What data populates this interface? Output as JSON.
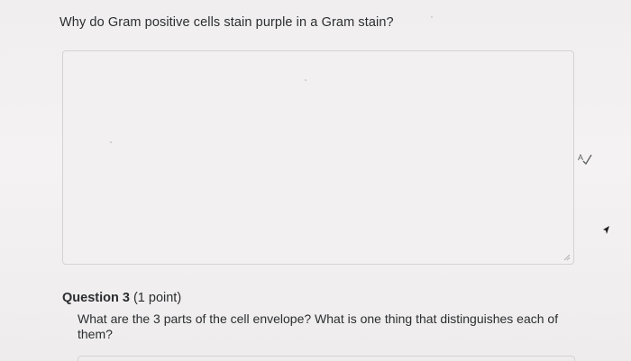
{
  "question2": {
    "prompt": "Why do Gram positive cells stain purple in a Gram stain?",
    "answer_value": ""
  },
  "question3": {
    "title": "Question 3",
    "points": "(1 point)",
    "prompt": "What are the 3 parts of the cell envelope? What is one thing that distinguishes each of them?"
  },
  "icons": {
    "spellcheck": "spellcheck-icon",
    "resize": "resize-grip-icon",
    "cursor": "mouse-cursor-icon"
  },
  "colors": {
    "background": "#f0eeee",
    "text": "#2b2e31",
    "border": "#d4d2d2"
  }
}
